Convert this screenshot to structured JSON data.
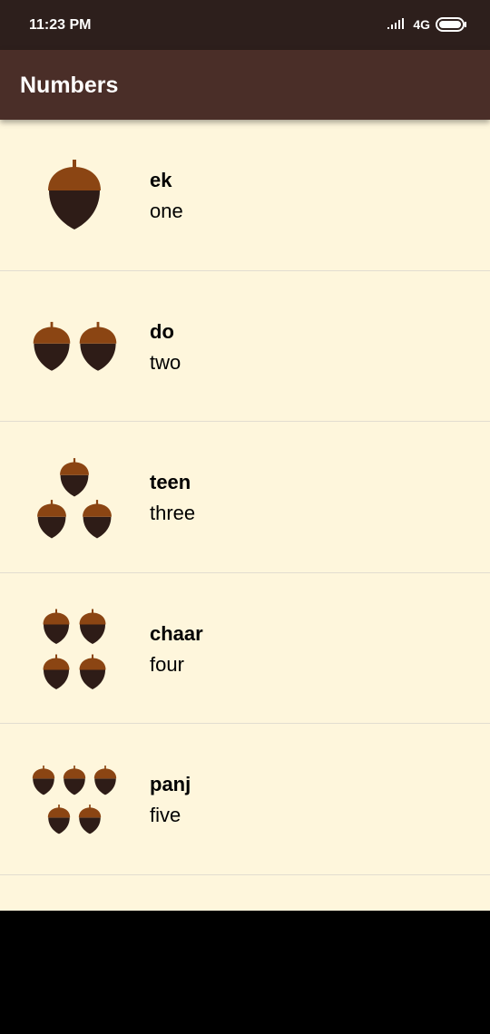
{
  "status_bar": {
    "time": "11:23 PM",
    "network": "4G",
    "network_sub": "..ll",
    "icons": [
      "signal-icon",
      "battery-icon"
    ]
  },
  "app_bar": {
    "title": "Numbers"
  },
  "colors": {
    "status_bar": "#2d1f1c",
    "app_bar": "#4a2e28",
    "list_background": "#fef6dc",
    "acorn_cap": "#8b4513",
    "acorn_body": "#2e1c17"
  },
  "items": [
    {
      "hindi": "ek",
      "english": "one",
      "icon": "acorn-1-icon",
      "count": 1
    },
    {
      "hindi": "do",
      "english": "two",
      "icon": "acorn-2-icon",
      "count": 2
    },
    {
      "hindi": "teen",
      "english": "three",
      "icon": "acorn-3-icon",
      "count": 3
    },
    {
      "hindi": "chaar",
      "english": "four",
      "icon": "acorn-4-icon",
      "count": 4
    },
    {
      "hindi": "panj",
      "english": "five",
      "icon": "acorn-5-icon",
      "count": 5
    }
  ]
}
